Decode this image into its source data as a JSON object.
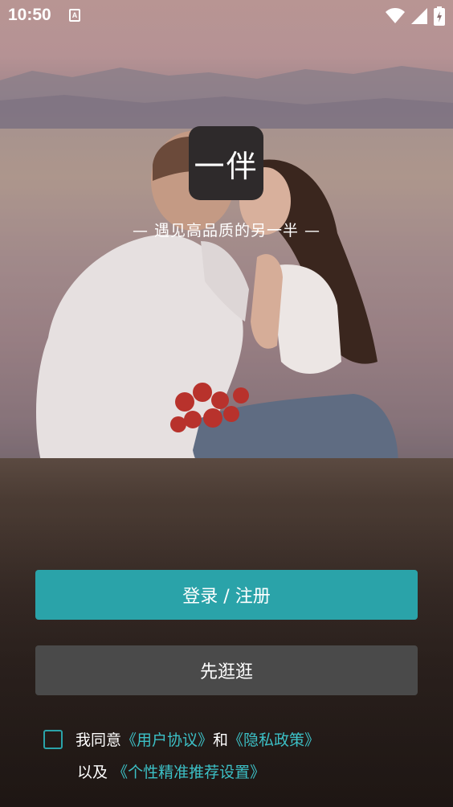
{
  "status_bar": {
    "time": "10:50",
    "app_indicator": "A",
    "icons": [
      "wifi-icon",
      "signal-icon",
      "battery-charging-icon"
    ]
  },
  "logo": {
    "text": "一伴"
  },
  "tagline": "— 遇见高品质的另一半 —",
  "buttons": {
    "login_label": "登录 / 注册",
    "browse_label": "先逛逛"
  },
  "agreement": {
    "prefix": "我同意",
    "user_agreement": "《用户协议》",
    "and": "和",
    "privacy_policy": "《隐私政策》",
    "also": "以及",
    "personalized": "《个性精准推荐设置》"
  },
  "colors": {
    "accent": "#2aa3a9",
    "link": "#3cc0c6",
    "secondary_button": "#4a4a4a",
    "logo_bg": "#2e2a2b"
  }
}
